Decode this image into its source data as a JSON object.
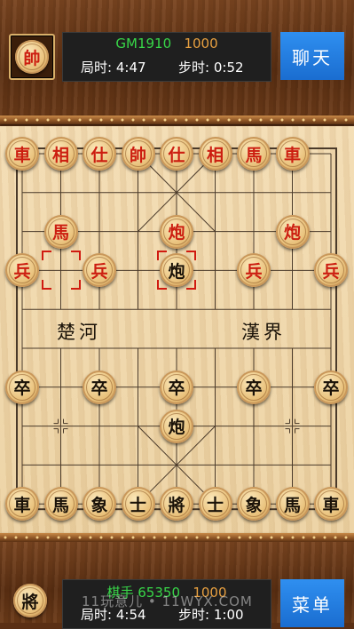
{
  "top": {
    "opponent_avatar_char": "帥",
    "name": "GM1910",
    "score": "1000",
    "game_time_label": "局时:",
    "game_time": "4:47",
    "step_time_label": "步时:",
    "step_time": "0:52",
    "chat_button": "聊天"
  },
  "bottom": {
    "player_avatar_char": "將",
    "name": "棋手 65350",
    "score": "1000",
    "game_time_label": "局时:",
    "game_time": "4:54",
    "step_time_label": "步时:",
    "step_time": "1:00",
    "menu_button": "菜单",
    "watermark": "11玩意儿 • 11WYX.COM"
  },
  "board": {
    "river_left": "楚河",
    "river_right": "漢界",
    "pieces": [
      {
        "char": "車",
        "side": "red",
        "file": 0,
        "rank": 0
      },
      {
        "char": "相",
        "side": "red",
        "file": 1,
        "rank": 0
      },
      {
        "char": "仕",
        "side": "red",
        "file": 2,
        "rank": 0
      },
      {
        "char": "帥",
        "side": "red",
        "file": 3,
        "rank": 0
      },
      {
        "char": "仕",
        "side": "red",
        "file": 4,
        "rank": 0
      },
      {
        "char": "相",
        "side": "red",
        "file": 5,
        "rank": 0
      },
      {
        "char": "馬",
        "side": "red",
        "file": 6,
        "rank": 0
      },
      {
        "char": "車",
        "side": "red",
        "file": 7,
        "rank": 0
      },
      {
        "char": "馬",
        "side": "red",
        "file": 1,
        "rank": 2
      },
      {
        "char": "炮",
        "side": "red",
        "file": 4,
        "rank": 2
      },
      {
        "char": "炮",
        "side": "red",
        "file": 7,
        "rank": 2
      },
      {
        "char": "兵",
        "side": "red",
        "file": 0,
        "rank": 3
      },
      {
        "char": "兵",
        "side": "red",
        "file": 2,
        "rank": 3
      },
      {
        "char": "兵",
        "side": "red",
        "file": 6,
        "rank": 3
      },
      {
        "char": "兵",
        "side": "red",
        "file": 8,
        "rank": 3
      },
      {
        "char": "炮",
        "side": "black",
        "file": 4,
        "rank": 3
      },
      {
        "char": "卒",
        "side": "black",
        "file": 0,
        "rank": 6
      },
      {
        "char": "卒",
        "side": "black",
        "file": 2,
        "rank": 6
      },
      {
        "char": "卒",
        "side": "black",
        "file": 4,
        "rank": 6
      },
      {
        "char": "卒",
        "side": "black",
        "file": 6,
        "rank": 6
      },
      {
        "char": "卒",
        "side": "black",
        "file": 8,
        "rank": 6
      },
      {
        "char": "炮",
        "side": "black",
        "file": 4,
        "rank": 7
      },
      {
        "char": "車",
        "side": "black",
        "file": 0,
        "rank": 9
      },
      {
        "char": "馬",
        "side": "black",
        "file": 1,
        "rank": 9
      },
      {
        "char": "象",
        "side": "black",
        "file": 2,
        "rank": 9
      },
      {
        "char": "士",
        "side": "black",
        "file": 3,
        "rank": 9
      },
      {
        "char": "將",
        "side": "black",
        "file": 4,
        "rank": 9
      },
      {
        "char": "士",
        "side": "black",
        "file": 5,
        "rank": 9
      },
      {
        "char": "象",
        "side": "black",
        "file": 6,
        "rank": 9
      },
      {
        "char": "馬",
        "side": "black",
        "file": 7,
        "rank": 9
      },
      {
        "char": "車",
        "side": "black",
        "file": 8,
        "rank": 9
      }
    ],
    "last_move_markers": [
      {
        "file": 1,
        "rank": 3
      },
      {
        "file": 4,
        "rank": 3
      }
    ]
  },
  "colors": {
    "red_piece_text": "#cc1e10",
    "black_piece_text": "#1a1208",
    "button_blue": "#1a6dd0",
    "name_green": "#38d648",
    "score_orange": "#e8a040"
  }
}
